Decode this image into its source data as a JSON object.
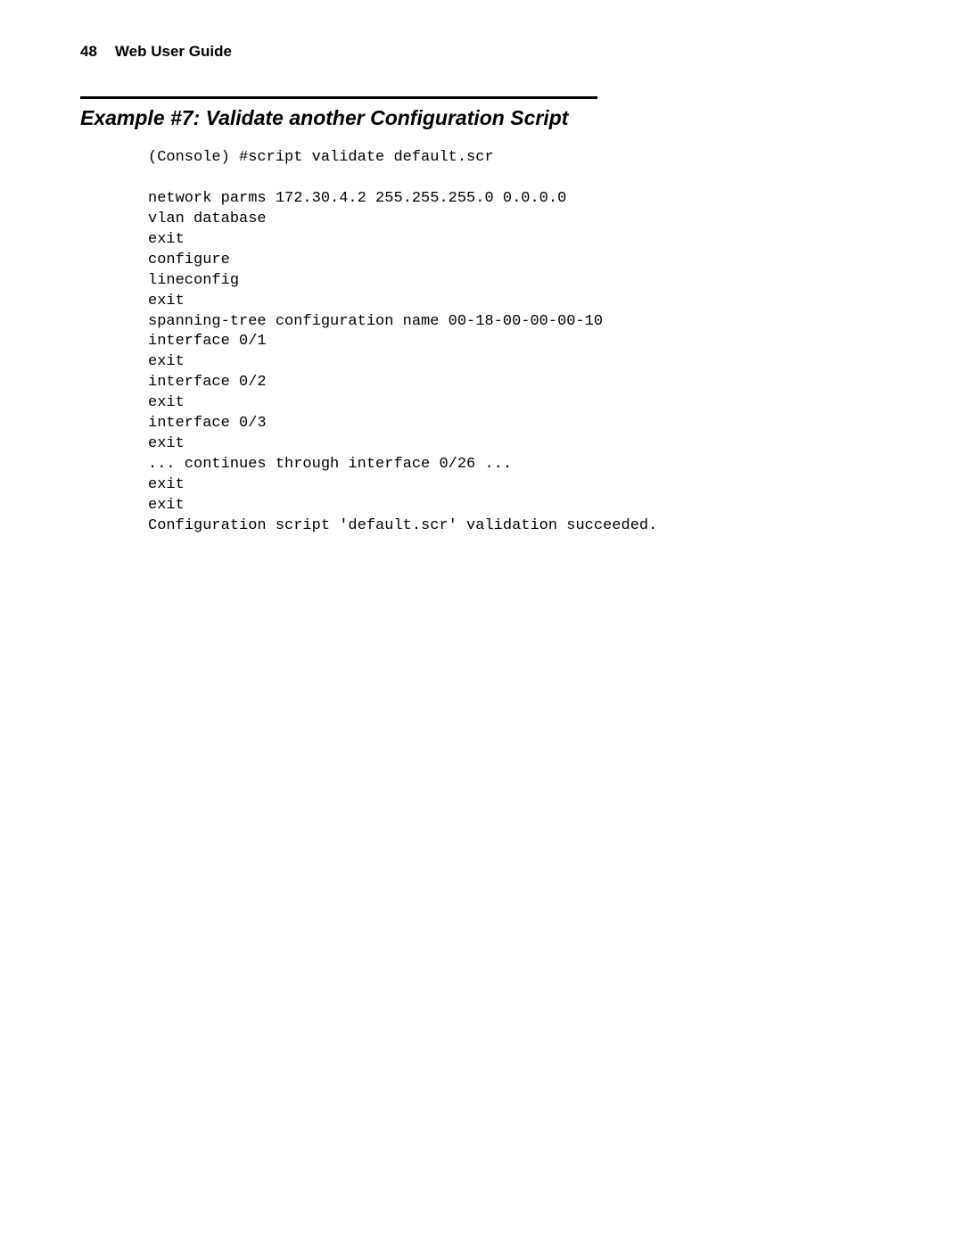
{
  "header": {
    "page_number": "48",
    "guide_title": "Web User Guide"
  },
  "section": {
    "title": "Example #7: Validate another Configuration Script"
  },
  "code": {
    "content": "(Console) #script validate default.scr\n\nnetwork parms 172.30.4.2 255.255.255.0 0.0.0.0\nvlan database\nexit\nconfigure\nlineconfig\nexit\nspanning-tree configuration name 00-18-00-00-00-10\ninterface 0/1\nexit\ninterface 0/2\nexit\ninterface 0/3\nexit\n... continues through interface 0/26 ...\nexit\nexit\nConfiguration script 'default.scr' validation succeeded."
  }
}
